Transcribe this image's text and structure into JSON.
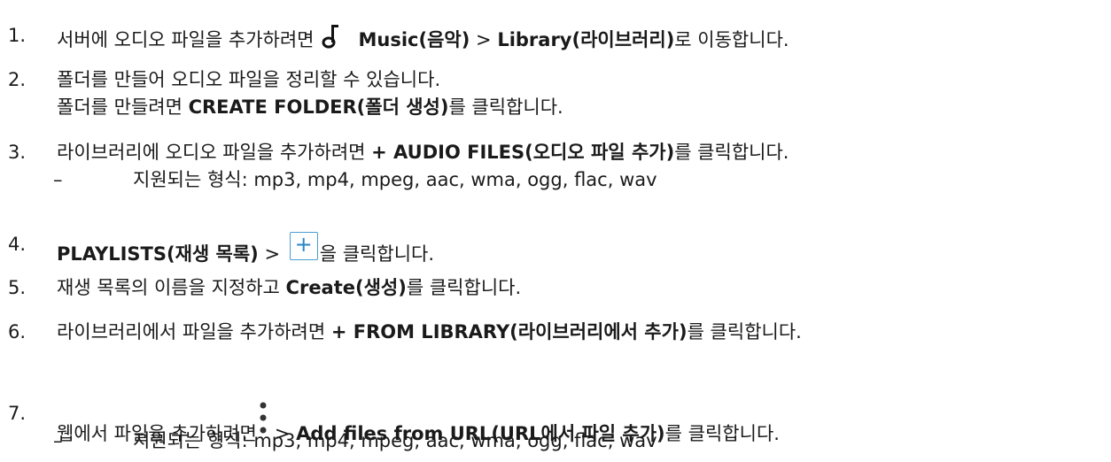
{
  "steps": [
    {
      "num": "1.",
      "t1": "서버에 오디오 파일을 추가하려면",
      "icon": "music-note-icon",
      "b1": "Music(음악)",
      "t2": " > ",
      "b2": "Library(라이브러리)",
      "t3": "로 이동합니다."
    },
    {
      "num": "2.",
      "line1": "폴더를 만들어 오디오 파일을 정리할 수 있습니다.",
      "t1": "폴더를 만들려면 ",
      "b1": "CREATE FOLDER(폴더 생성)",
      "t2": "를 클릭합니다."
    },
    {
      "num": "3.",
      "t1": "라이브러리에 오디오 파일을 추가하려면 ",
      "b1": "+ AUDIO FILES(오디오 파일 추가)",
      "t2": "를 클릭합니다.",
      "sub_dash": "–",
      "sub_text": "지원되는 형식: mp3, mp4, mpeg, aac, wma, ogg, flac, wav"
    },
    {
      "num": "4.",
      "b1": "PLAYLISTS(재생 목록)",
      "t1": " > ",
      "icon": "plus-icon",
      "icon_glyph": "+",
      "t2": "을 클릭합니다."
    },
    {
      "num": "5.",
      "t1": "재생 목록의 이름을 지정하고 ",
      "b1": "Create(생성)",
      "t2": "를 클릭합니다."
    },
    {
      "num": "6.",
      "t1": "라이브러리에서 파일을 추가하려면 ",
      "b1": "+ FROM LIBRARY(라이브러리에서 추가)",
      "t2": "를 클릭합니다."
    },
    {
      "num": "7.",
      "t1": "웹에서 파일을 추가하려면",
      "icon": "more-vertical-icon",
      "t2": "> ",
      "b1": "Add files from URL(URL에서 파일 추가)",
      "t3": "를 클릭합니다.",
      "sub_dash": "–",
      "sub_text": "지원되는 형식: mp3, mp4, mpeg, aac, wma, ogg, flac, wav"
    }
  ]
}
